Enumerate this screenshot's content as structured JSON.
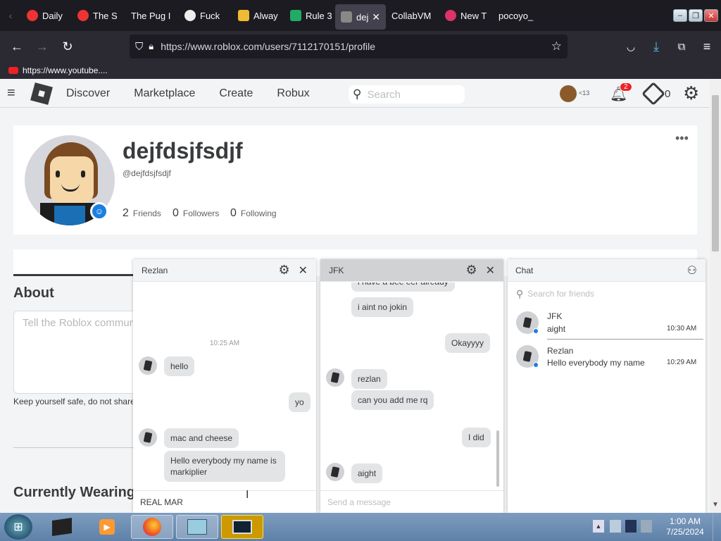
{
  "browser": {
    "tabs": [
      {
        "label": "Daily",
        "color": "#e33"
      },
      {
        "label": "The S",
        "color": "#e33"
      },
      {
        "label": "The Pug I",
        "color": "#555"
      },
      {
        "label": "Fuck",
        "color": "#ddd"
      },
      {
        "label": "Alway",
        "color": "#eb3"
      },
      {
        "label": "Rule 3",
        "color": "#2a6"
      },
      {
        "label": "dej",
        "color": "#888"
      },
      {
        "label": "CollabVM",
        "color": "#1c1b22"
      },
      {
        "label": "New T",
        "color": "#d36"
      },
      {
        "label": "pocoyo_",
        "color": "#1c1b22"
      }
    ],
    "url": "https://www.roblox.com/users/7112170151/profile",
    "bookmark": "https://www.youtube...."
  },
  "roblox": {
    "nav": [
      "Discover",
      "Marketplace",
      "Create",
      "Robux"
    ],
    "search_placeholder": "Search",
    "notif_count": "2",
    "robux": "0",
    "friend_badge": "13"
  },
  "profile": {
    "display_name": "dejfdsjfsdjf",
    "username": "@dejfdsjfsdjf",
    "friends_count": "2",
    "friends_label": "Friends",
    "followers_count": "0",
    "followers_label": "Followers",
    "following_count": "0",
    "following_label": "Following",
    "about_title": "About",
    "about_placeholder": "Tell the Roblox community",
    "safety_text": "Keep yourself safe, do not share",
    "wearing_title": "Currently Wearing"
  },
  "chat_rezlan": {
    "title": "Rezlan",
    "timestamp": "10:25 AM",
    "msg1": "hello",
    "msg2": "yo",
    "msg3": "mac and cheese",
    "msg4": "Hello everybody my name is markiplier",
    "input": "REAL MAR"
  },
  "chat_jfk": {
    "title": "JFK",
    "msg0": "i have a bee eer already",
    "msg1": "i aint no jokin",
    "msg2": "Okayyyy",
    "msg3": "rezlan",
    "msg4": "can you add me rq",
    "msg5": "I did",
    "msg6": "aight",
    "placeholder": "Send a message"
  },
  "chat_list": {
    "title": "Chat",
    "search_placeholder": "Search for friends",
    "items": [
      {
        "name": "JFK",
        "preview": "aight",
        "time": "10:30 AM"
      },
      {
        "name": "Rezlan",
        "preview": "Hello everybody my name",
        "time": "10:29 AM"
      }
    ]
  },
  "taskbar": {
    "time": "1:00 AM",
    "date": "7/25/2024"
  }
}
